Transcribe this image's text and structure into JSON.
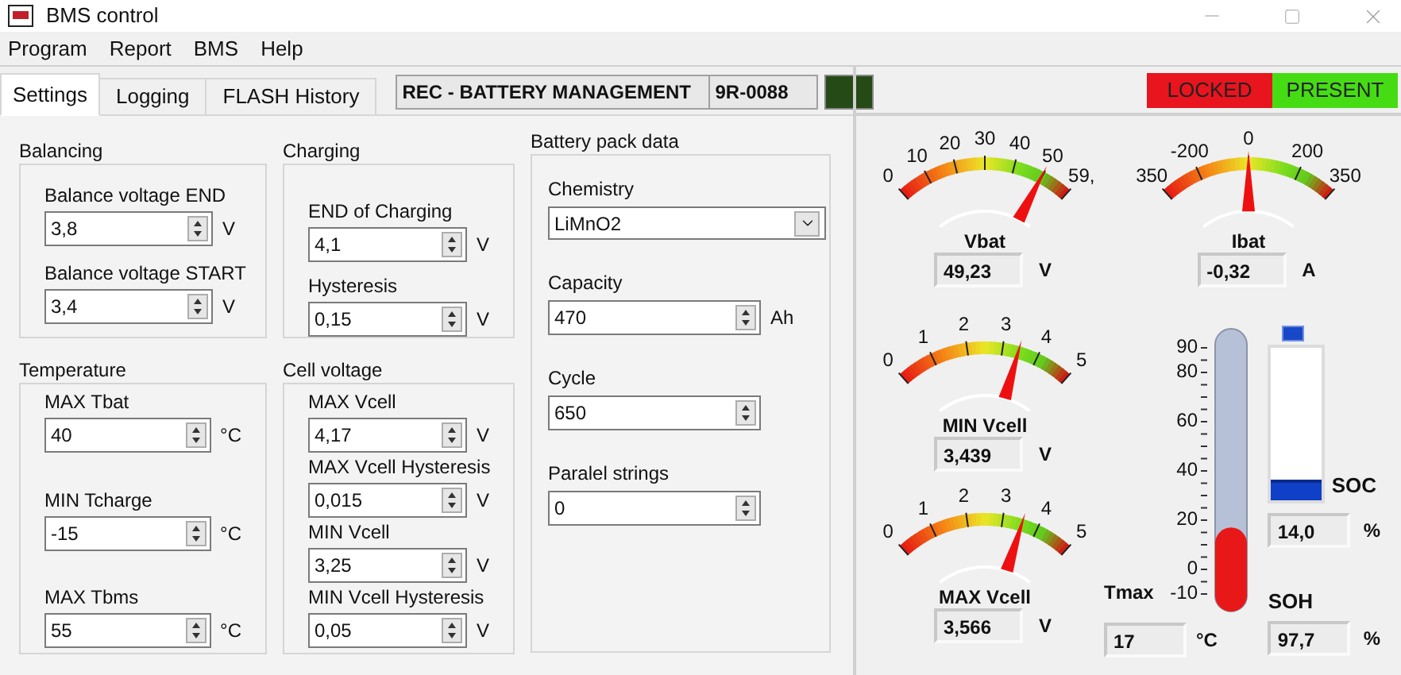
{
  "window": {
    "title": "BMS control"
  },
  "menu": [
    "Program",
    "Report",
    "BMS",
    "Help"
  ],
  "tabs": [
    {
      "label": "Settings",
      "selected": true
    },
    {
      "label": "Logging",
      "selected": false
    },
    {
      "label": "FLASH History",
      "selected": false
    }
  ],
  "device": {
    "name": "REC - BATTERY MANAGEMENT",
    "serial": "9R-0088",
    "led_on": false
  },
  "indicators": [
    {
      "label": "LOCKED",
      "color": "#e8141e"
    },
    {
      "label": "PRESENT",
      "color": "#46dc14"
    }
  ],
  "groups": [
    {
      "title": "Balancing",
      "fields": [
        {
          "label": "Balance voltage END",
          "value": "3,8",
          "unit": "V"
        },
        {
          "label": "Balance voltage START",
          "value": "3,4",
          "unit": "V"
        }
      ]
    },
    {
      "title": "Charging",
      "fields": [
        {
          "label": "END of Charging",
          "value": "4,1",
          "unit": "V"
        },
        {
          "label": "Hysteresis",
          "value": "0,15",
          "unit": "V"
        }
      ]
    },
    {
      "title": "Temperature",
      "fields": [
        {
          "label": "MAX Tbat",
          "value": "40",
          "unit": "°C"
        },
        {
          "label": "MIN Tcharge",
          "value": "-15",
          "unit": "°C"
        },
        {
          "label": "MAX Tbms",
          "value": "55",
          "unit": "°C"
        }
      ]
    },
    {
      "title": "Cell voltage",
      "fields": [
        {
          "label": "MAX Vcell",
          "value": "4,17",
          "unit": "V"
        },
        {
          "label": "MAX Vcell Hysteresis",
          "value": "0,015",
          "unit": "V"
        },
        {
          "label": "MIN Vcell",
          "value": "3,25",
          "unit": "V"
        },
        {
          "label": "MIN Vcell Hysteresis",
          "value": "0,05",
          "unit": "V"
        }
      ]
    }
  ],
  "battery_pack": {
    "title": "Battery pack data",
    "fields": [
      {
        "kind": "dropdown",
        "label": "Chemistry",
        "value": "LiMnO2"
      },
      {
        "kind": "spinner",
        "label": "Capacity",
        "value": "470",
        "unit": "Ah"
      },
      {
        "kind": "spinner",
        "label": "Cycle",
        "value": "650"
      },
      {
        "kind": "spinner",
        "label": "Paralel strings",
        "value": "0"
      }
    ]
  },
  "gauges": [
    {
      "title": "Vbat",
      "ticks": [
        "0",
        "10",
        "20",
        "30",
        "40",
        "50",
        "59,"
      ],
      "level": 0.83,
      "value": "49,23",
      "unit": "V"
    },
    {
      "title": "Ibat",
      "ticks": [
        "350",
        "-200",
        "0",
        "200",
        "350"
      ],
      "level": 0.5,
      "value": "-0,32",
      "unit": "A"
    },
    {
      "title": "MIN Vcell",
      "ticks": [
        "0",
        "1",
        "2",
        "3",
        "4",
        "5"
      ],
      "level": 0.69,
      "value": "3,439",
      "unit": "V"
    },
    {
      "title": "MAX Vcell",
      "ticks": [
        "0",
        "1",
        "2",
        "3",
        "4",
        "5"
      ],
      "level": 0.71,
      "value": "3,566",
      "unit": "V"
    }
  ],
  "thermometer": {
    "title": "Tmax",
    "ticks": [
      "90",
      "80",
      "60",
      "40",
      "20",
      "0",
      "-10"
    ],
    "level": 0.27,
    "value": "17",
    "unit": "°C"
  },
  "soc": {
    "label": "SOC",
    "level": 0.14,
    "value": "14,0",
    "unit": "%"
  },
  "soh": {
    "label": "SOH",
    "value": "97,7",
    "unit": "%"
  }
}
